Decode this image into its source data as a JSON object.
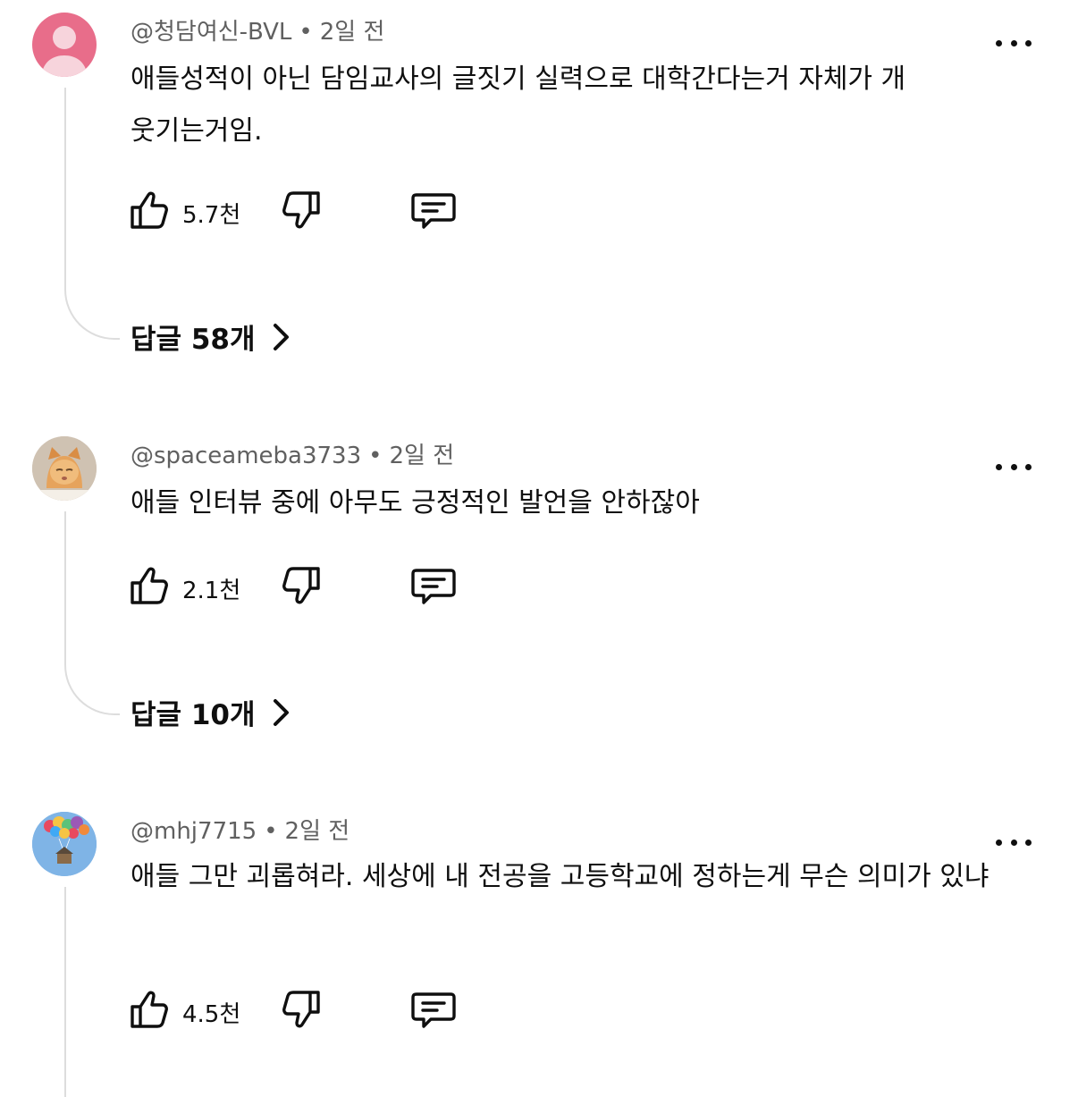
{
  "comments": [
    {
      "author": "@청담여신-BVL",
      "time": "2일 전",
      "text": "애들성적이 아닌 담임교사의 글짓기 실력으로 대학간다는거 자체가 개 웃기는거임.",
      "likes": "5.7천",
      "replies": "답글 58개",
      "avatar": "pink-default-avatar"
    },
    {
      "author": "@spaceameba3733",
      "time": "2일 전",
      "text": "애들 인터뷰 중에 아무도 긍정적인 발언을 안하잖아",
      "likes": "2.1천",
      "replies": "답글 10개",
      "avatar": "cat-photo-avatar"
    },
    {
      "author": "@mhj7715",
      "time": "2일 전",
      "text": "애들 그만 괴롭혀라. 세상에 내 전공을 고등학교에 정하는게 무슨 의미가 있냐",
      "likes": "4.5천",
      "avatar": "balloon-house-avatar"
    }
  ],
  "icons": {
    "like": "thumbs-up-icon",
    "dislike": "thumbs-down-icon",
    "reply": "comment-icon",
    "more": "more-options-icon",
    "chevron": "chevron-right-icon"
  },
  "colors": {
    "text": "#0f0f0f",
    "meta": "#606060",
    "thread": "#dddddd",
    "avatar_pink": "#e86d8a"
  }
}
